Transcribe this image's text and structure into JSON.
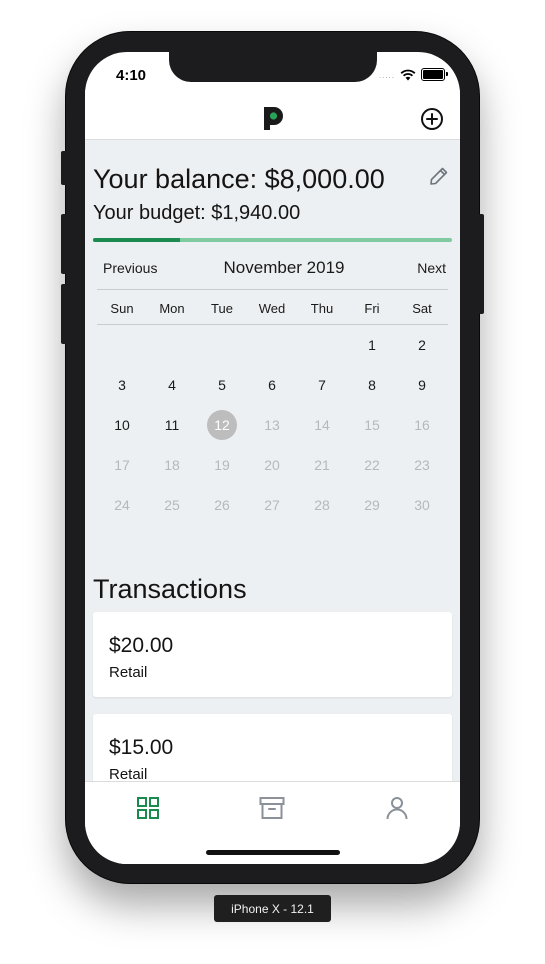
{
  "status_bar": {
    "time": "4:10",
    "signal": "....."
  },
  "appbar": {
    "logo_icon": "p-logo-icon",
    "add_icon": "plus-circle-icon"
  },
  "summary": {
    "balance_text": "Your balance: $8,000.00",
    "budget_text": "Your budget: $1,940.00",
    "edit_icon": "pencil-icon",
    "budget_progress_fraction": 0.243,
    "progress_colors": {
      "filled": "#1a8a4f",
      "remaining": "#7fcaa0"
    }
  },
  "calendar": {
    "prev_label": "Previous",
    "month_label": "November 2019",
    "next_label": "Next",
    "weekdays": [
      "Sun",
      "Mon",
      "Tue",
      "Wed",
      "Thu",
      "Fri",
      "Sat"
    ],
    "weeks": [
      [
        "",
        "",
        "",
        "",
        "",
        "1",
        "2"
      ],
      [
        "3",
        "4",
        "5",
        "6",
        "7",
        "8",
        "9"
      ],
      [
        "10",
        "11",
        "12",
        "13",
        "14",
        "15",
        "16"
      ],
      [
        "17",
        "18",
        "19",
        "20",
        "21",
        "22",
        "23"
      ],
      [
        "24",
        "25",
        "26",
        "27",
        "28",
        "29",
        "30"
      ]
    ],
    "today": "12"
  },
  "transactions": {
    "title": "Transactions",
    "items": [
      {
        "amount": "$20.00",
        "category": "Retail"
      },
      {
        "amount": "$15.00",
        "category": "Retail"
      }
    ]
  },
  "tabs": [
    {
      "icon": "grid-icon",
      "active": true
    },
    {
      "icon": "archive-icon",
      "active": false
    },
    {
      "icon": "person-icon",
      "active": false
    }
  ],
  "colors": {
    "accent": "#1a8a4f",
    "inactive_tab": "#8a9199"
  },
  "device_label": "iPhone X - 12.1"
}
